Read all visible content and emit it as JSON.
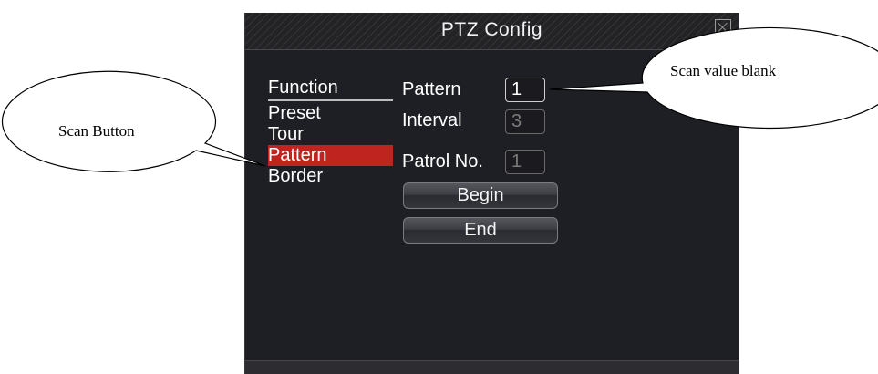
{
  "dialog": {
    "title": "PTZ Config"
  },
  "menu": {
    "header": "Function",
    "items": [
      {
        "label": "Preset"
      },
      {
        "label": "Tour"
      },
      {
        "label": "Pattern"
      },
      {
        "label": "Border"
      }
    ],
    "selected": "Pattern"
  },
  "form": {
    "fields": [
      {
        "label": "Pattern",
        "value": "1"
      },
      {
        "label": "Interval",
        "value": "3"
      },
      {
        "label": "Patrol No.",
        "value": "1"
      }
    ],
    "buttons": [
      {
        "label": "Begin"
      },
      {
        "label": "End"
      }
    ]
  },
  "callouts": {
    "scan_value": "Scan value blank",
    "scan_button": "Scan Button"
  },
  "colors": {
    "dialog_bg": "#1e1f24",
    "selected_bg": "#c0241e",
    "text": "#ffffff"
  },
  "icons": {
    "close": "close-icon"
  }
}
